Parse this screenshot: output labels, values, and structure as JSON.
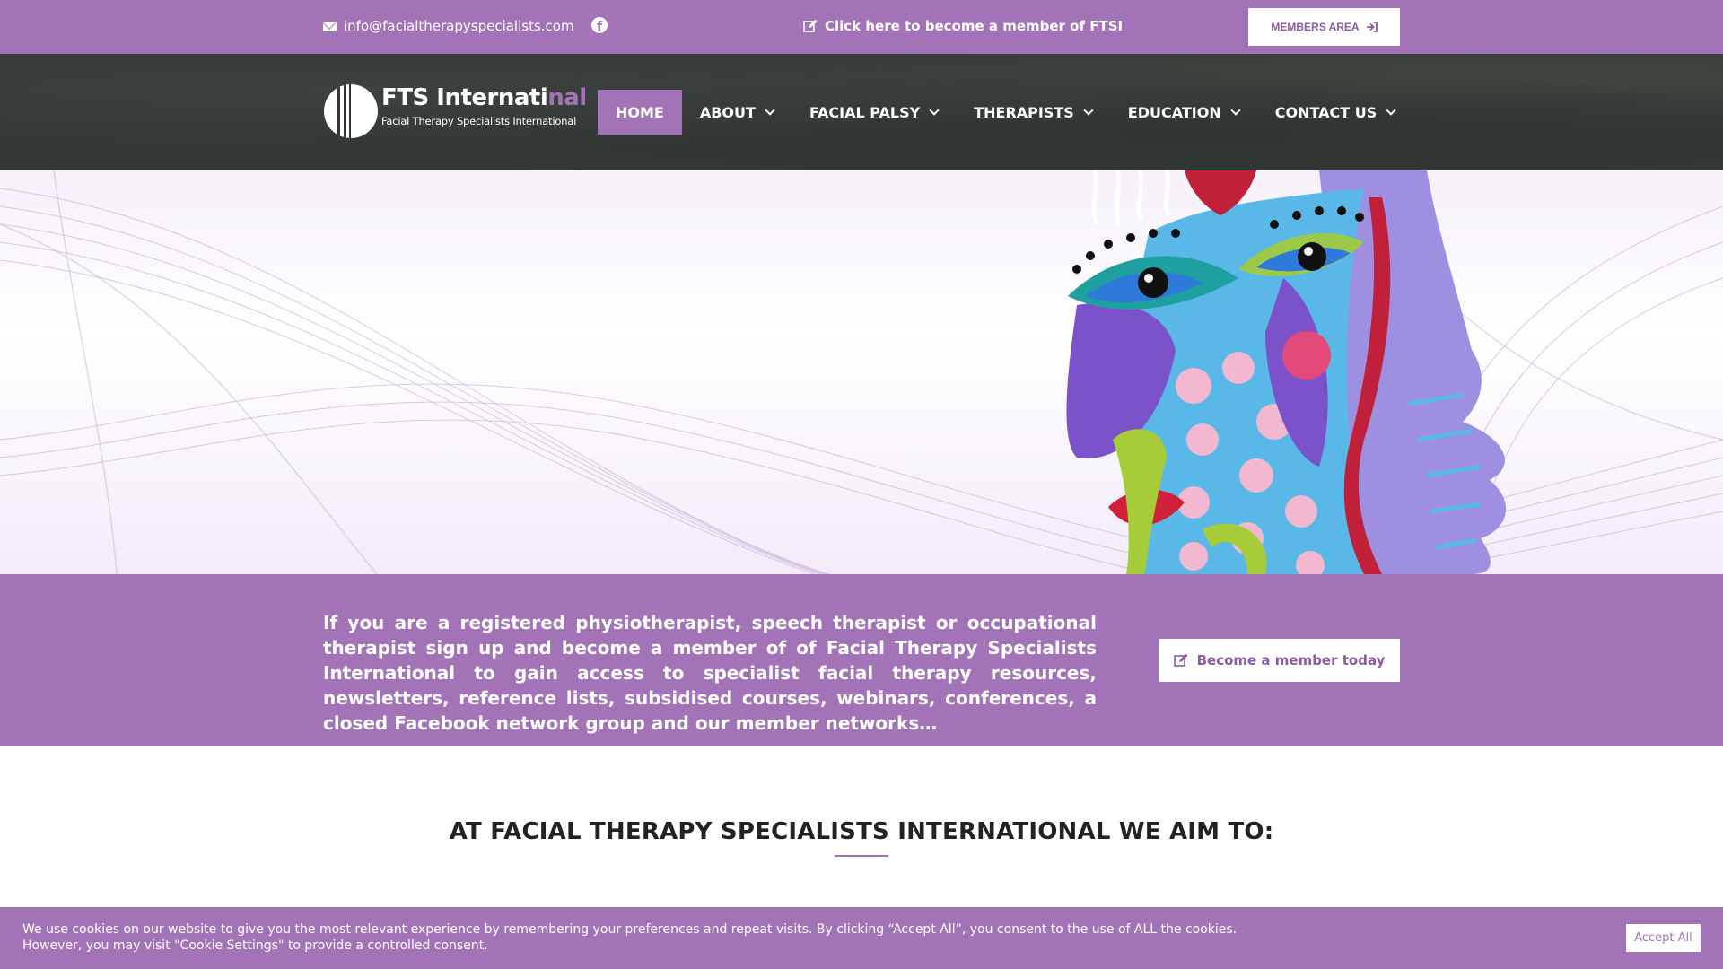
{
  "topbar": {
    "email": "info@facialtherapyspecialists.com",
    "member_link": "Click here to become a member of FTSI",
    "members_area": "MEMBERS AREA"
  },
  "logo": {
    "title_main": "FTS Internati",
    "title_accent": "nal",
    "subtitle": "Facial Therapy Specialists International"
  },
  "nav": {
    "items": [
      {
        "label": "HOME"
      },
      {
        "label": "ABOUT"
      },
      {
        "label": "FACIAL PALSY"
      },
      {
        "label": "THERAPISTS"
      },
      {
        "label": "EDUCATION"
      },
      {
        "label": "CONTACT US"
      }
    ],
    "active_index": 0
  },
  "band": {
    "text": "If you are a registered physiotherapist, speech therapist or occupational therapist sign up and become a member of of Facial Therapy Specialists International to gain access to specialist facial therapy resources, newsletters, reference lists, subsidised courses, webinars, conferences, a closed Facebook network group and our member networks…",
    "button": "Become a member today"
  },
  "aims": {
    "title": "AT FACIAL THERAPY SPECIALISTS INTERNATIONAL WE AIM TO:"
  },
  "cookie": {
    "text": "We use cookies on our website to give you the most relevant experience by remembering your preferences and repeat visits. By clicking “Accept All”, you consent to the use of ALL the cookies. However, you may visit \"Cookie Settings\" to provide a controlled consent.",
    "accept": "Accept All"
  },
  "colors": {
    "brand_purple": "#a274b7",
    "nav_dark": "#343937"
  },
  "icons": [
    "envelope-icon",
    "facebook-icon",
    "edit-icon",
    "sign-in-icon",
    "chevron-down-icon"
  ]
}
